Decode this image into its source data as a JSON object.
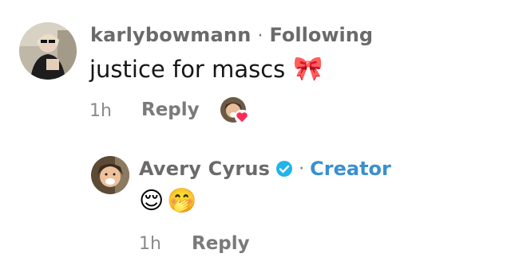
{
  "comment": {
    "username": "karlybowmann",
    "separator": "·",
    "relation": "Following",
    "text": "justice for mascs",
    "emoji": "🎀",
    "time": "1h",
    "reply_label": "Reply"
  },
  "reply": {
    "username": "Avery Cyrus",
    "separator": "·",
    "badge_label": "Creator",
    "emojis": [
      "😌",
      "🤭"
    ],
    "time": "1h",
    "reply_label": "Reply"
  },
  "colors": {
    "creator_blue": "#3a8fd0",
    "verified_blue": "#20b4ea",
    "heart_red": "#fe2c55",
    "ribbon_pink": "#f5a3c0"
  }
}
